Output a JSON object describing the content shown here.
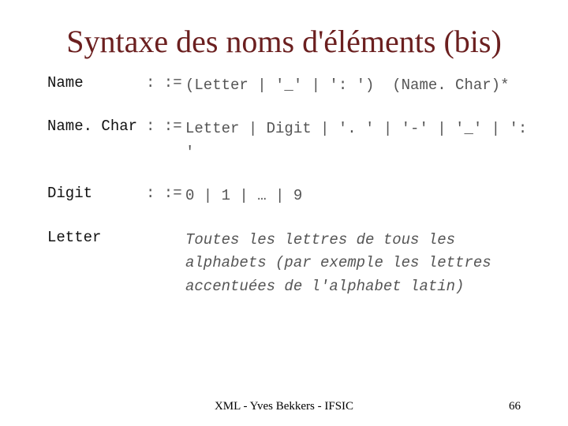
{
  "title": "Syntaxe des noms d'éléments (bis)",
  "rules": [
    {
      "lhs": "Name",
      "sep": ": :=",
      "rhs": "(Letter | '_' | ': ')  (Name. Char)*",
      "italic": false
    },
    {
      "lhs": "Name. Char",
      "sep": ": :=",
      "rhs": "Letter | Digit | '. ' | '-' | '_' | ': '",
      "italic": false
    },
    {
      "lhs": "Digit",
      "sep": ": :=",
      "rhs": "0 | 1 | … | 9",
      "italic": false
    },
    {
      "lhs": "Letter",
      "sep": "",
      "rhs": "Toutes les lettres de tous les alphabets (par exemple les lettres accentuées de l'alphabet latin)",
      "italic": true
    }
  ],
  "footer": {
    "center": "XML - Yves Bekkers - IFSIC",
    "page": "66"
  }
}
